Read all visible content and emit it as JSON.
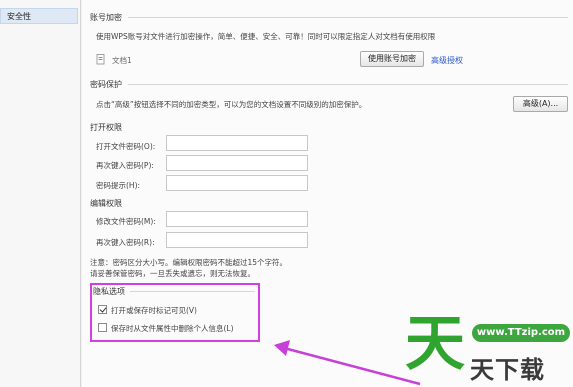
{
  "sidebar": {
    "items": [
      {
        "label": "安全性"
      }
    ]
  },
  "account_encryption": {
    "title": "账号加密",
    "description": "使用WPS账号对文件进行加密操作，简单、便捷、安全、可靠！同时可以限定指定人对文档有使用权限",
    "document_name": "文档1",
    "button_label": "使用账号加密",
    "link_label": "高级授权"
  },
  "password_protection": {
    "title": "密码保护",
    "description": "点击“高级”按钮选择不同的加密类型，可以为您的文档设置不同级别的加密保护。",
    "advanced_button": "高级(A)...",
    "open_permission": {
      "title": "打开权限",
      "open_password_label": "打开文件密码(O):",
      "confirm_password_label": "再次键入密码(P):",
      "hint_label": "密码提示(H):"
    },
    "edit_permission": {
      "title": "编辑权限",
      "modify_password_label": "修改文件密码(M):",
      "confirm_password_label": "再次键入密码(R):"
    },
    "note_line1": "注意：密码区分大小写。编辑权限密码不能超过15个字符。",
    "note_line2": "请妥善保管密码，一旦丢失或遗忘，则无法恢复。"
  },
  "privacy": {
    "title": "隐私选项",
    "option1": {
      "label": "打开或保存时标记可见(V)",
      "checked": true
    },
    "option2": {
      "label": "保存时从文件属性中删除个人信息(L)",
      "checked": false
    }
  },
  "watermark": {
    "badge": "www.TTzip.com",
    "text": "天下载",
    "logo_char": "天"
  },
  "colors": {
    "highlight": "#d33fe0",
    "watermark_green": "#3ea63e",
    "link_blue": "#2a58c4"
  }
}
